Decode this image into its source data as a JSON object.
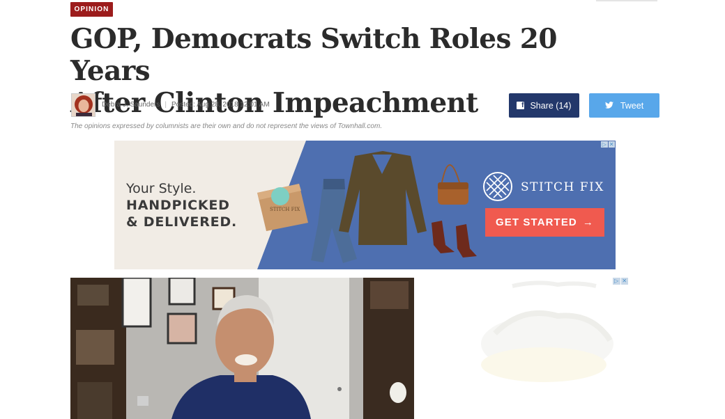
{
  "article": {
    "section_badge": "OPINION",
    "headline_line1": "GOP, Democrats Switch Roles 20 Years",
    "headline_line2": "After Clinton Impeachment",
    "author": "Debra J. Saunders",
    "separator": "|",
    "posted": "Posted: Aug 28, 2018 12:01 AM",
    "disclaimer": "The opinions expressed by columnists are their own and do not represent the views of Townhall.com."
  },
  "share": {
    "facebook_label": "Share (14)",
    "facebook_icon": "f",
    "twitter_label": "Tweet"
  },
  "banner_ad": {
    "line1": "Your Style.",
    "line2": "HANDPICKED",
    "line3": "& DELIVERED.",
    "box_label": "STITCH FIX",
    "brand": "STITCH FIX",
    "cta": "GET STARTED",
    "cta_arrow": "→",
    "choices_a": "▷",
    "choices_b": "✕"
  },
  "side_ad": {
    "choices_a": "▷",
    "choices_b": "✕"
  },
  "colors": {
    "badge": "#9c1c1c",
    "facebook": "#23386b",
    "twitter": "#58a7ea",
    "ad_blue": "#4e6fb0",
    "cta": "#f05a4f"
  },
  "icons": {
    "facebook": "facebook-icon",
    "twitter": "twitter-icon",
    "ad_choices": "ad-choices-icon"
  }
}
